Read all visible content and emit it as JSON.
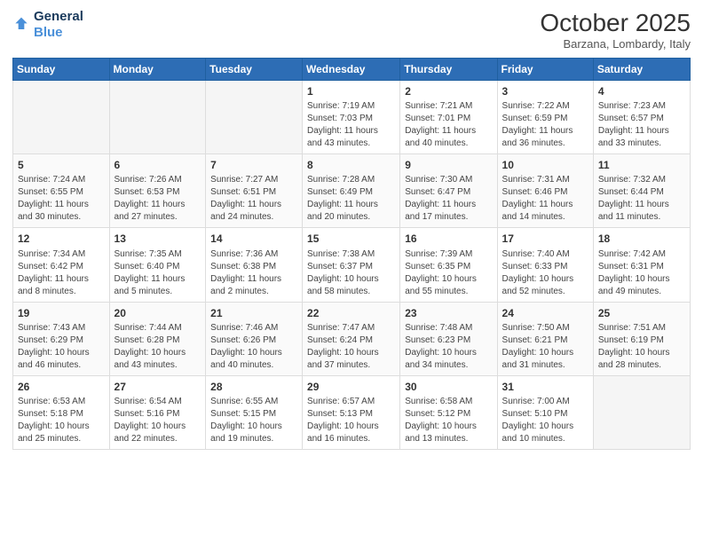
{
  "logo": {
    "line1": "General",
    "line2": "Blue"
  },
  "title": "October 2025",
  "location": "Barzana, Lombardy, Italy",
  "weekdays": [
    "Sunday",
    "Monday",
    "Tuesday",
    "Wednesday",
    "Thursday",
    "Friday",
    "Saturday"
  ],
  "weeks": [
    [
      {
        "day": "",
        "info": ""
      },
      {
        "day": "",
        "info": ""
      },
      {
        "day": "",
        "info": ""
      },
      {
        "day": "1",
        "info": "Sunrise: 7:19 AM\nSunset: 7:03 PM\nDaylight: 11 hours\nand 43 minutes."
      },
      {
        "day": "2",
        "info": "Sunrise: 7:21 AM\nSunset: 7:01 PM\nDaylight: 11 hours\nand 40 minutes."
      },
      {
        "day": "3",
        "info": "Sunrise: 7:22 AM\nSunset: 6:59 PM\nDaylight: 11 hours\nand 36 minutes."
      },
      {
        "day": "4",
        "info": "Sunrise: 7:23 AM\nSunset: 6:57 PM\nDaylight: 11 hours\nand 33 minutes."
      }
    ],
    [
      {
        "day": "5",
        "info": "Sunrise: 7:24 AM\nSunset: 6:55 PM\nDaylight: 11 hours\nand 30 minutes."
      },
      {
        "day": "6",
        "info": "Sunrise: 7:26 AM\nSunset: 6:53 PM\nDaylight: 11 hours\nand 27 minutes."
      },
      {
        "day": "7",
        "info": "Sunrise: 7:27 AM\nSunset: 6:51 PM\nDaylight: 11 hours\nand 24 minutes."
      },
      {
        "day": "8",
        "info": "Sunrise: 7:28 AM\nSunset: 6:49 PM\nDaylight: 11 hours\nand 20 minutes."
      },
      {
        "day": "9",
        "info": "Sunrise: 7:30 AM\nSunset: 6:47 PM\nDaylight: 11 hours\nand 17 minutes."
      },
      {
        "day": "10",
        "info": "Sunrise: 7:31 AM\nSunset: 6:46 PM\nDaylight: 11 hours\nand 14 minutes."
      },
      {
        "day": "11",
        "info": "Sunrise: 7:32 AM\nSunset: 6:44 PM\nDaylight: 11 hours\nand 11 minutes."
      }
    ],
    [
      {
        "day": "12",
        "info": "Sunrise: 7:34 AM\nSunset: 6:42 PM\nDaylight: 11 hours\nand 8 minutes."
      },
      {
        "day": "13",
        "info": "Sunrise: 7:35 AM\nSunset: 6:40 PM\nDaylight: 11 hours\nand 5 minutes."
      },
      {
        "day": "14",
        "info": "Sunrise: 7:36 AM\nSunset: 6:38 PM\nDaylight: 11 hours\nand 2 minutes."
      },
      {
        "day": "15",
        "info": "Sunrise: 7:38 AM\nSunset: 6:37 PM\nDaylight: 10 hours\nand 58 minutes."
      },
      {
        "day": "16",
        "info": "Sunrise: 7:39 AM\nSunset: 6:35 PM\nDaylight: 10 hours\nand 55 minutes."
      },
      {
        "day": "17",
        "info": "Sunrise: 7:40 AM\nSunset: 6:33 PM\nDaylight: 10 hours\nand 52 minutes."
      },
      {
        "day": "18",
        "info": "Sunrise: 7:42 AM\nSunset: 6:31 PM\nDaylight: 10 hours\nand 49 minutes."
      }
    ],
    [
      {
        "day": "19",
        "info": "Sunrise: 7:43 AM\nSunset: 6:29 PM\nDaylight: 10 hours\nand 46 minutes."
      },
      {
        "day": "20",
        "info": "Sunrise: 7:44 AM\nSunset: 6:28 PM\nDaylight: 10 hours\nand 43 minutes."
      },
      {
        "day": "21",
        "info": "Sunrise: 7:46 AM\nSunset: 6:26 PM\nDaylight: 10 hours\nand 40 minutes."
      },
      {
        "day": "22",
        "info": "Sunrise: 7:47 AM\nSunset: 6:24 PM\nDaylight: 10 hours\nand 37 minutes."
      },
      {
        "day": "23",
        "info": "Sunrise: 7:48 AM\nSunset: 6:23 PM\nDaylight: 10 hours\nand 34 minutes."
      },
      {
        "day": "24",
        "info": "Sunrise: 7:50 AM\nSunset: 6:21 PM\nDaylight: 10 hours\nand 31 minutes."
      },
      {
        "day": "25",
        "info": "Sunrise: 7:51 AM\nSunset: 6:19 PM\nDaylight: 10 hours\nand 28 minutes."
      }
    ],
    [
      {
        "day": "26",
        "info": "Sunrise: 6:53 AM\nSunset: 5:18 PM\nDaylight: 10 hours\nand 25 minutes."
      },
      {
        "day": "27",
        "info": "Sunrise: 6:54 AM\nSunset: 5:16 PM\nDaylight: 10 hours\nand 22 minutes."
      },
      {
        "day": "28",
        "info": "Sunrise: 6:55 AM\nSunset: 5:15 PM\nDaylight: 10 hours\nand 19 minutes."
      },
      {
        "day": "29",
        "info": "Sunrise: 6:57 AM\nSunset: 5:13 PM\nDaylight: 10 hours\nand 16 minutes."
      },
      {
        "day": "30",
        "info": "Sunrise: 6:58 AM\nSunset: 5:12 PM\nDaylight: 10 hours\nand 13 minutes."
      },
      {
        "day": "31",
        "info": "Sunrise: 7:00 AM\nSunset: 5:10 PM\nDaylight: 10 hours\nand 10 minutes."
      },
      {
        "day": "",
        "info": ""
      }
    ]
  ]
}
